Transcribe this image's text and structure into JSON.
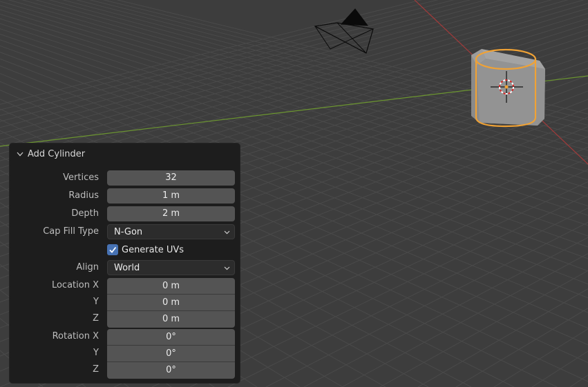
{
  "viewport": {
    "colors": {
      "background": "#3d3d3d",
      "grid": "#4a4a4a",
      "x_axis": "#b03434",
      "y_axis": "#6f9a2e",
      "selection": "#f0a235"
    },
    "objects": [
      "camera",
      "cube",
      "cylinder-selected",
      "3d-cursor"
    ]
  },
  "operator_panel": {
    "title": "Add Cylinder",
    "icon": "chevron-down-icon",
    "fields": {
      "vertices": {
        "label": "Vertices",
        "value": "32"
      },
      "radius": {
        "label": "Radius",
        "value": "1 m"
      },
      "depth": {
        "label": "Depth",
        "value": "2 m"
      },
      "cap_fill_type": {
        "label": "Cap Fill Type",
        "value": "N-Gon"
      },
      "generate_uvs": {
        "label": "Generate UVs",
        "checked": true
      },
      "align": {
        "label": "Align",
        "value": "World"
      },
      "location": {
        "label_x": "Location X",
        "label_y": "Y",
        "label_z": "Z",
        "x": "0 m",
        "y": "0 m",
        "z": "0 m"
      },
      "rotation": {
        "label_x": "Rotation X",
        "label_y": "Y",
        "label_z": "Z",
        "x": "0°",
        "y": "0°",
        "z": "0°"
      }
    }
  }
}
